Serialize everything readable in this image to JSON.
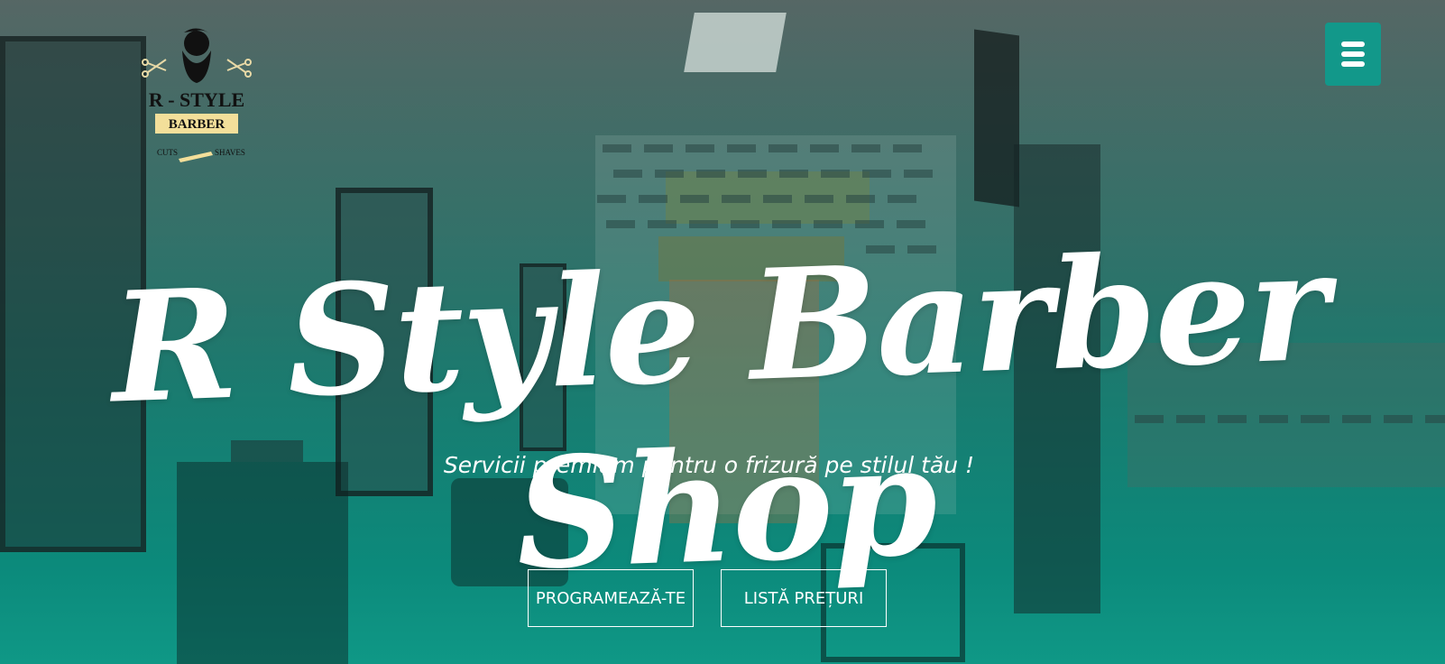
{
  "logo": {
    "line1": "R - STYLE",
    "line2": "BARBER",
    "left_tag": "CUTS",
    "right_tag": "SHAVES"
  },
  "header": {
    "menu_icon": "hamburger-icon",
    "accent_color": "#12988a"
  },
  "hero": {
    "title": "R Style Barber Shop",
    "subtitle": "Servicii premium pentru o frizură pe stilul tău !",
    "buttons": {
      "book": "PROGRAMEAZĂ-TE",
      "prices": "LISTĂ PREȚURI"
    }
  }
}
